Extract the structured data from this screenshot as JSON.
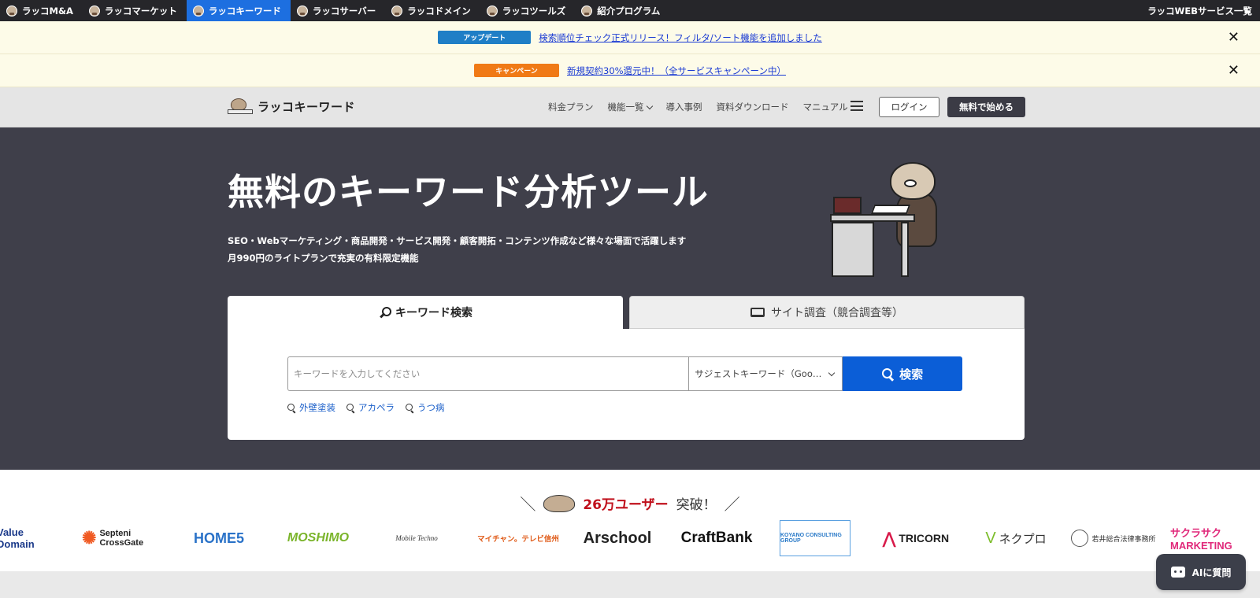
{
  "topnav": {
    "sites": [
      {
        "label": "ラッコM&A",
        "active": false
      },
      {
        "label": "ラッコマーケット",
        "active": false
      },
      {
        "label": "ラッコキーワード",
        "active": true
      },
      {
        "label": "ラッコサーバー",
        "active": false
      },
      {
        "label": "ラッコドメイン",
        "active": false
      },
      {
        "label": "ラッコツールズ",
        "active": false
      },
      {
        "label": "紹介プログラム",
        "active": false
      }
    ],
    "all_services": "ラッコWEBサービス一覧"
  },
  "notices": [
    {
      "badge": "アップデート",
      "text": "検索順位チェック正式リリース！フィルタ/ソート機能を追加しました",
      "close": "✕"
    },
    {
      "badge": "キャンペーン",
      "text": "新規契約30%還元中！（全サービスキャンペーン中）",
      "close": "✕"
    }
  ],
  "header": {
    "logo_text": "ラッコキーワード",
    "nav": [
      "料金プラン",
      "機能一覧",
      "導入事例",
      "資料ダウンロード",
      "マニュアル"
    ],
    "login": "ログイン",
    "signup": "無料で始める"
  },
  "hero": {
    "title": "無料のキーワード分析ツール",
    "subtitle1": "SEO・Webマーケティング・商品開発・サービス開発・顧客開拓・コンテンツ作成など様々な場面で活躍します",
    "subtitle2": "月990円のライトプランで充実の有料限定機能"
  },
  "search": {
    "tabs": [
      {
        "label": "キーワード検索",
        "icon": "key-icon"
      },
      {
        "label": "サイト調査（競合調査等）",
        "icon": "laptop-icon"
      }
    ],
    "placeholder": "キーワードを入力してください",
    "suggest_select": "サジェストキーワード（Googl…",
    "button": "検索",
    "examples": [
      "外壁塗装",
      "アカペラ",
      "うつ病"
    ]
  },
  "users": {
    "slash_left": "＼",
    "count": "26万ユーザー",
    "suffix": "突破！",
    "slash_right": "／",
    "logos": [
      "Value Domain",
      "Septeni CrossGate",
      "HOME5",
      "MOSHIMO",
      "Mobile Techno",
      "マイチャン。テレビ信州",
      "Arschool",
      "CraftBank",
      "KOYANO CONSULTING GROUP",
      "TRICORN",
      "ネクプロ",
      "若井総合法律事務所",
      "サクラサク MARKETING"
    ]
  },
  "ai_button": "AIに質問",
  "colors": {
    "accent": "#0b5ed7",
    "hero_bg": "#3f3f4a",
    "topbar": "#26262a",
    "highlight": "#c0101c"
  }
}
